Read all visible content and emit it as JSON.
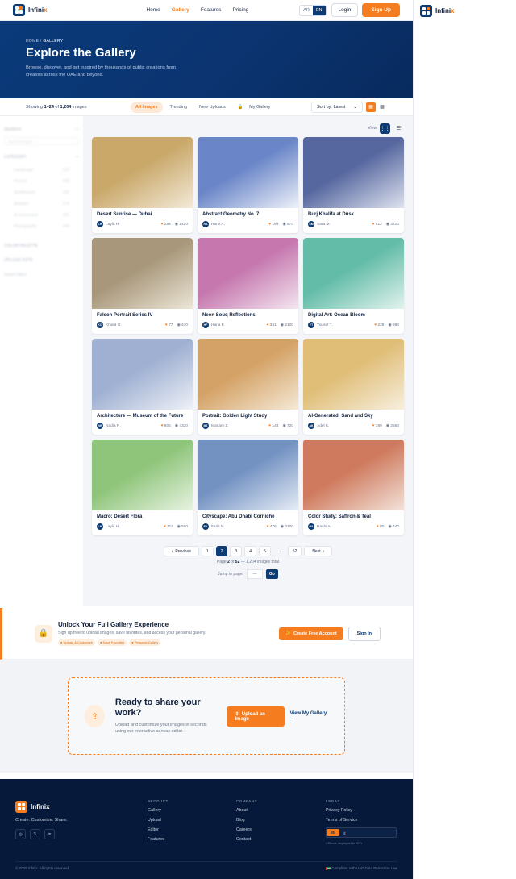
{
  "brand": {
    "name_a": "Infini",
    "name_b": "x",
    "name": "Infinix"
  },
  "nav": {
    "links": [
      {
        "label": "Home"
      },
      {
        "label": "Gallery",
        "active": true
      },
      {
        "label": "Features"
      },
      {
        "label": "Pricing"
      }
    ],
    "lang_ar": "AR",
    "lang_en": "EN",
    "login": "Login",
    "signup": "Sign Up"
  },
  "hero": {
    "crumb_home": "HOME",
    "crumb_sep": "/",
    "crumb_current": "GALLERY",
    "title": "Explore the Gallery",
    "subtitle": "Browse, discover, and get inspired by thousands of public creations from creators across the UAE and beyond."
  },
  "toolbar": {
    "showing_prefix": "Showing",
    "range": "1–24",
    "of": "of",
    "total": "1,204",
    "suffix": "images",
    "tabs": [
      "All Images",
      "Trending",
      "New Uploads",
      "My Gallery"
    ],
    "sort": "Sort by: Latest"
  },
  "filters": {
    "search_title": "SEARCH",
    "search_placeholder": "Search images...",
    "category_title": "CATEGORY",
    "categories": [
      {
        "label": "Landscape",
        "count": "312"
      },
      {
        "label": "Portrait",
        "count": "268"
      },
      {
        "label": "Architecture",
        "count": "195"
      },
      {
        "label": "Abstract",
        "count": "174"
      },
      {
        "label": "AI-Generated",
        "count": "151"
      },
      {
        "label": "Photography",
        "count": "104"
      }
    ],
    "palette_title": "COLOR PALETTE",
    "date_title": "UPLOAD DATE",
    "reset": "Reset Filters"
  },
  "view_label": "View",
  "cards": [
    {
      "title": "Desert Sunrise — Dubai",
      "initials": "LH",
      "author": "Layla H.",
      "likes": "284",
      "views": "1420",
      "c1": "#c9a86a",
      "c2": "#f3ead8"
    },
    {
      "title": "Abstract Geometry No. 7",
      "initials": "RA",
      "author": "Rami A.",
      "likes": "193",
      "views": "870",
      "c1": "#6a86c8",
      "c2": "#eef1f9"
    },
    {
      "title": "Burj Khalifa at Dusk",
      "initials": "SM",
      "author": "Sara M.",
      "likes": "512",
      "views": "3210",
      "c1": "#56679f",
      "c2": "#dfe3ef"
    },
    {
      "title": "Falcon Portrait Series IV",
      "initials": "KO",
      "author": "Khalid O.",
      "likes": "77",
      "views": "430",
      "c1": "#a8977a",
      "c2": "#ece6d8"
    },
    {
      "title": "Neon Souq Reflections",
      "initials": "HF",
      "author": "Hana F.",
      "likes": "341",
      "views": "2100",
      "c1": "#c577ae",
      "c2": "#f4e6f0"
    },
    {
      "title": "Digital Art: Ocean Bloom",
      "initials": "YT",
      "author": "Yousef T.",
      "likes": "228",
      "views": "980",
      "c1": "#63bca8",
      "c2": "#e3f3ee"
    },
    {
      "title": "Architecture — Museum of the Future",
      "initials": "NR",
      "author": "Nadia R.",
      "likes": "605",
      "views": "4320",
      "c1": "#9fb0d2",
      "c2": "#eef1f7"
    },
    {
      "title": "Portrait: Golden Light Study",
      "initials": "MZ",
      "author": "Mariam Z.",
      "likes": "144",
      "views": "720",
      "c1": "#d4a266",
      "c2": "#f5e9d6"
    },
    {
      "title": "AI-Generated: Sand and Sky",
      "initials": "AK",
      "author": "Adel K.",
      "likes": "399",
      "views": "2560",
      "c1": "#e0be78",
      "c2": "#f7efde"
    },
    {
      "title": "Macro: Desert Flora",
      "initials": "LH",
      "author": "Layla H.",
      "likes": "111",
      "views": "590",
      "c1": "#8fc57b",
      "c2": "#e8f3e2"
    },
    {
      "title": "Cityscape: Abu Dhabi Corniche",
      "initials": "FN",
      "author": "Faris N.",
      "likes": "476",
      "views": "3100",
      "c1": "#7392c2",
      "c2": "#e6ecf6"
    },
    {
      "title": "Color Study: Saffron & Teal",
      "initials": "RA",
      "author": "Rashi A.",
      "likes": "80",
      "views": "440",
      "c1": "#cf7a5e",
      "c2": "#f3e3da"
    }
  ],
  "pagination": {
    "prev": "Previous",
    "pages": [
      "1",
      "2",
      "3",
      "4",
      "5",
      "…",
      "52"
    ],
    "next": "Next",
    "info_page": "Page",
    "current": "2",
    "info_of": "of",
    "total_pages": "52",
    "info_rest": "— 1,204 images total",
    "jump_label": "Jump to page:",
    "jump_placeholder": "—",
    "go": "Go"
  },
  "promo": {
    "title": "Unlock Your Full Gallery Experience",
    "text": "Sign up free to upload images, save favorites, and access your personal gallery.",
    "tags": [
      "● Upload & Customize",
      "● Save Favorites",
      "● Personal Gallery"
    ],
    "cta_primary": "Create Free Account",
    "cta_secondary": "Sign In"
  },
  "share": {
    "title": "Ready to share your work?",
    "text": "Upload and customize your images in seconds using our interactive canvas editor.",
    "upload": "Upload an Image",
    "my_gallery": "View My Gallery →"
  },
  "footer": {
    "tagline": "Create. Customize. Share.",
    "product_title": "PRODUCT",
    "product": [
      "Gallery",
      "Upload",
      "Editor",
      "Features"
    ],
    "company_title": "COMPANY",
    "company": [
      "About",
      "Blog",
      "Careers",
      "Contact"
    ],
    "legal_title": "LEGAL",
    "legal": [
      "Privacy Policy",
      "Terms of Service"
    ],
    "lang_en": "EN",
    "lang_ar": "ع",
    "prices_note": "• Prices displayed in AED",
    "copyright": "© 2026 Infinix. All rights reserved.",
    "compliance": "Compliant with UAE Data Protection Law"
  },
  "colors": {
    "accent": "#f57c1f",
    "primary": "#0d3b73",
    "footer": "#06193a"
  }
}
